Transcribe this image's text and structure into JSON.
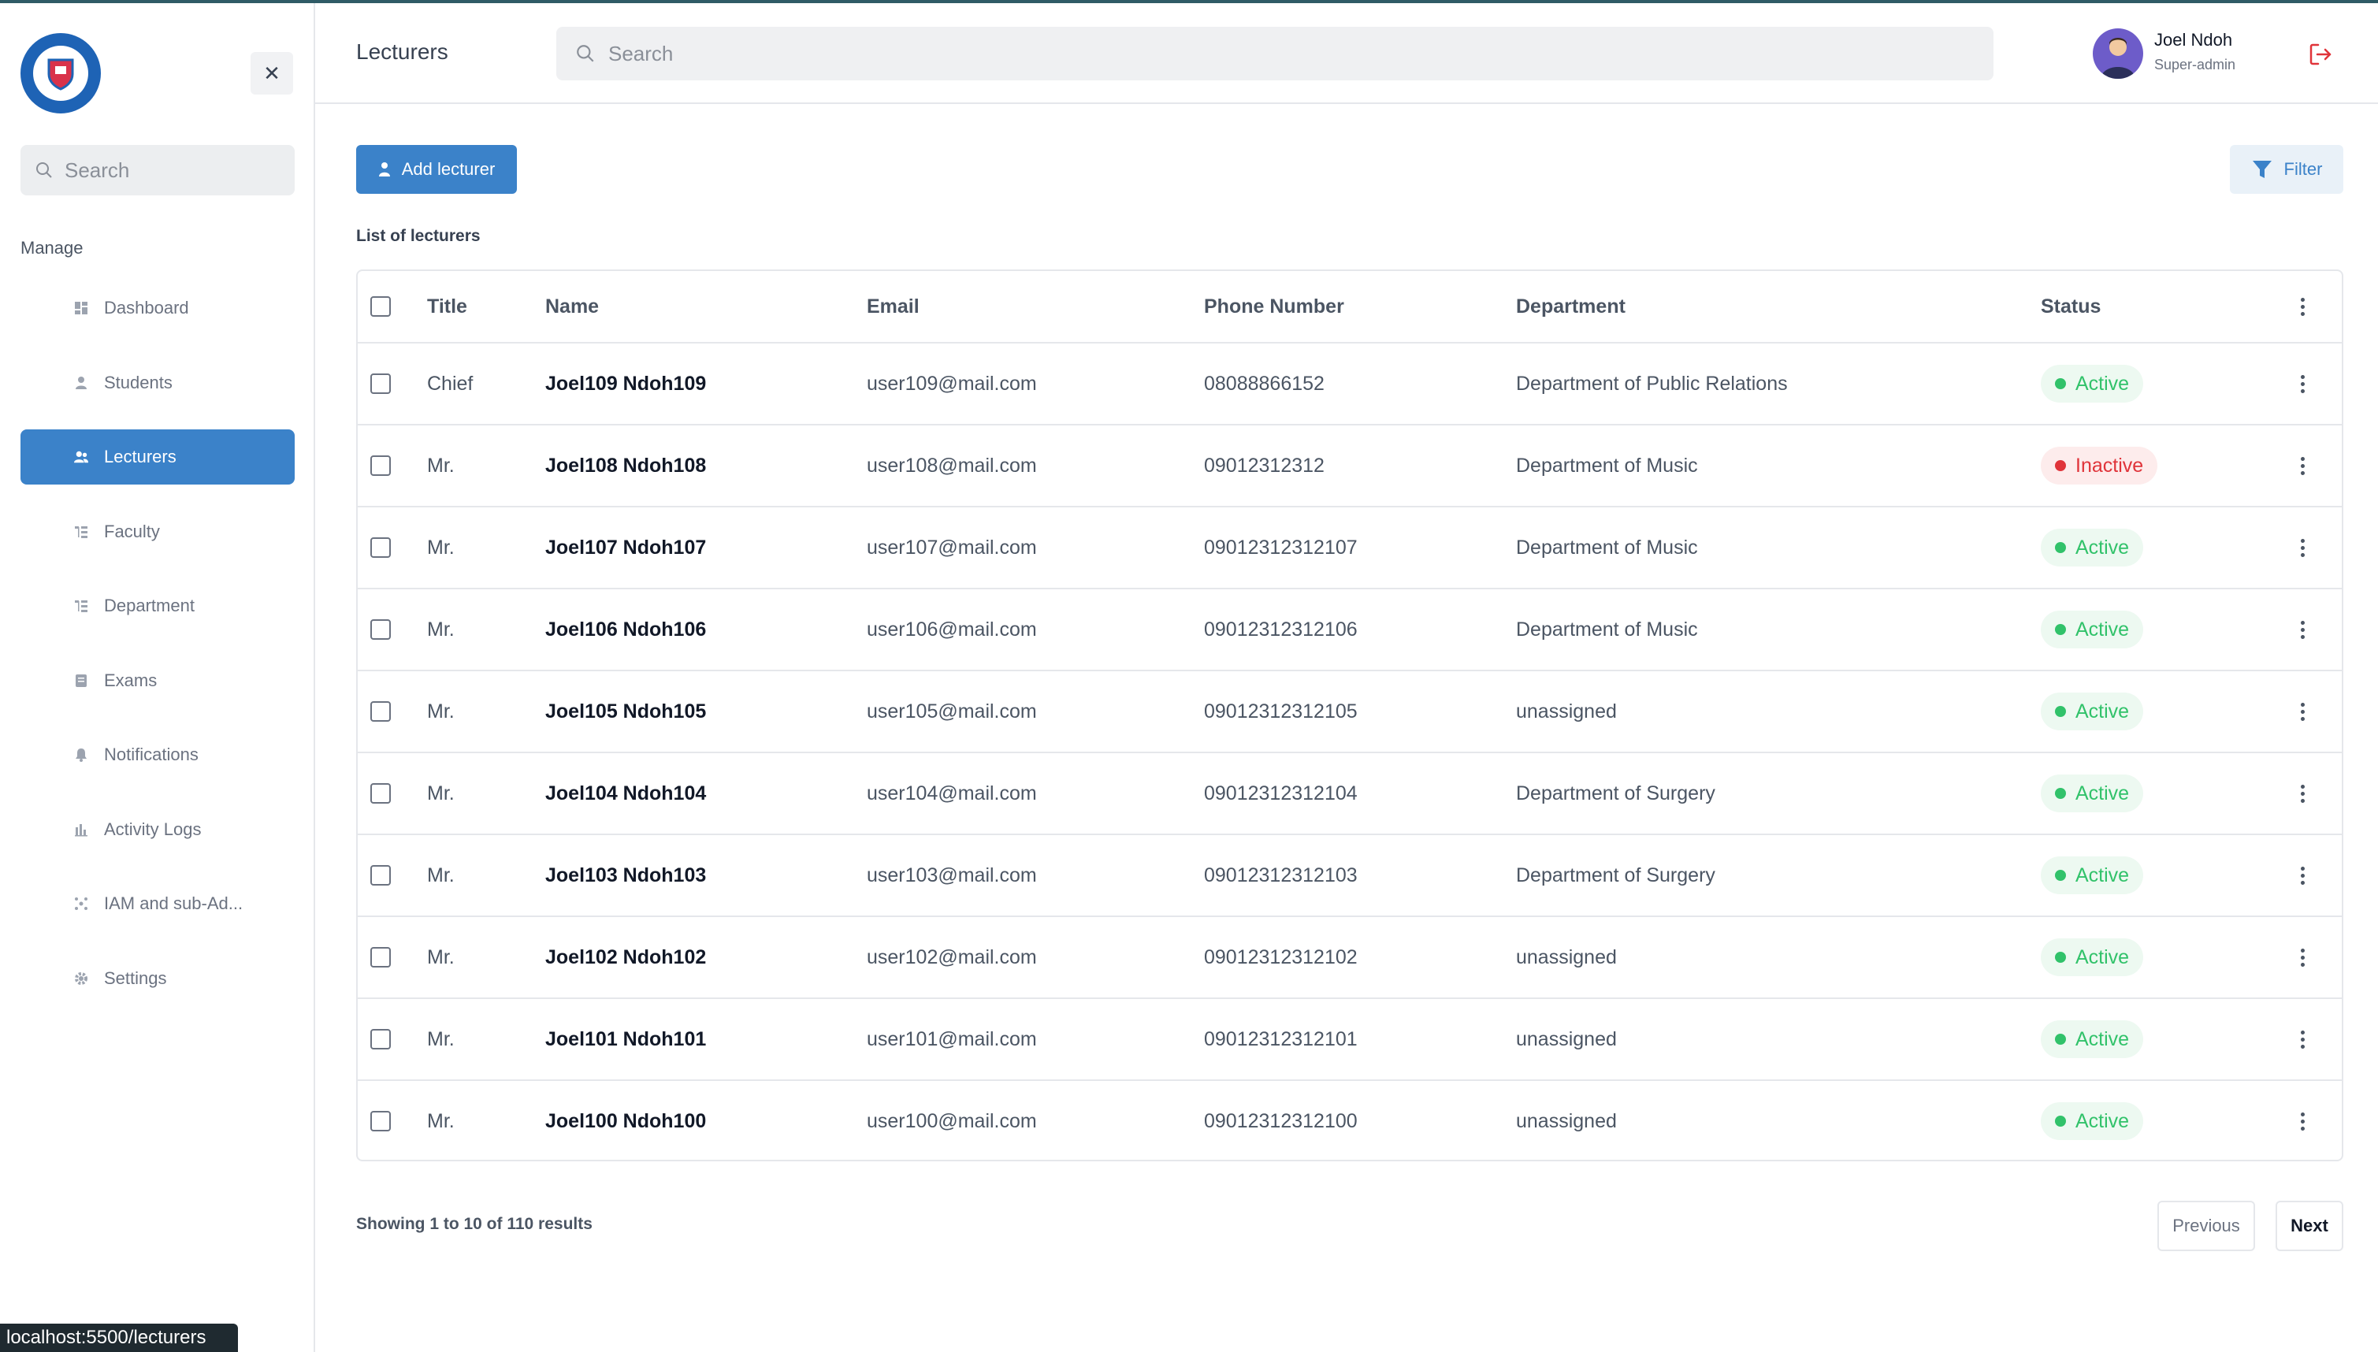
{
  "sidebar": {
    "search_placeholder": "Search",
    "section_label": "Manage",
    "items": [
      {
        "label": "Dashboard",
        "icon": "dashboard-icon"
      },
      {
        "label": "Students",
        "icon": "user-icon"
      },
      {
        "label": "Lecturers",
        "icon": "users-icon",
        "active": true
      },
      {
        "label": "Faculty",
        "icon": "tree-icon"
      },
      {
        "label": "Department",
        "icon": "tree-icon"
      },
      {
        "label": "Exams",
        "icon": "document-icon"
      },
      {
        "label": "Notifications",
        "icon": "bell-icon"
      },
      {
        "label": "Activity Logs",
        "icon": "bar-chart-icon"
      },
      {
        "label": "IAM and sub-Ad...",
        "icon": "network-icon"
      },
      {
        "label": "Settings",
        "icon": "gear-icon"
      }
    ]
  },
  "header": {
    "title": "Lecturers",
    "search_placeholder": "Search",
    "user_name": "Joel Ndoh",
    "user_role": "Super-admin"
  },
  "main": {
    "add_label": "Add lecturer",
    "filter_label": "Filter",
    "list_label": "List of lecturers",
    "columns": [
      "Title",
      "Name",
      "Email",
      "Phone Number",
      "Department",
      "Status"
    ],
    "rows": [
      {
        "title": "Chief",
        "name": "Joel109 Ndoh109",
        "email": "user109@mail.com",
        "phone": "08088866152",
        "department": "Department of Public Relations",
        "status": "Active"
      },
      {
        "title": "Mr.",
        "name": "Joel108 Ndoh108",
        "email": "user108@mail.com",
        "phone": "09012312312",
        "department": "Department of Music",
        "status": "Inactive"
      },
      {
        "title": "Mr.",
        "name": "Joel107 Ndoh107",
        "email": "user107@mail.com",
        "phone": "09012312312107",
        "department": "Department of Music",
        "status": "Active"
      },
      {
        "title": "Mr.",
        "name": "Joel106 Ndoh106",
        "email": "user106@mail.com",
        "phone": "09012312312106",
        "department": "Department of Music",
        "status": "Active"
      },
      {
        "title": "Mr.",
        "name": "Joel105 Ndoh105",
        "email": "user105@mail.com",
        "phone": "09012312312105",
        "department": "unassigned",
        "status": "Active"
      },
      {
        "title": "Mr.",
        "name": "Joel104 Ndoh104",
        "email": "user104@mail.com",
        "phone": "09012312312104",
        "department": "Department of Surgery",
        "status": "Active"
      },
      {
        "title": "Mr.",
        "name": "Joel103 Ndoh103",
        "email": "user103@mail.com",
        "phone": "09012312312103",
        "department": "Department of Surgery",
        "status": "Active"
      },
      {
        "title": "Mr.",
        "name": "Joel102 Ndoh102",
        "email": "user102@mail.com",
        "phone": "09012312312102",
        "department": "unassigned",
        "status": "Active"
      },
      {
        "title": "Mr.",
        "name": "Joel101 Ndoh101",
        "email": "user101@mail.com",
        "phone": "09012312312101",
        "department": "unassigned",
        "status": "Active"
      },
      {
        "title": "Mr.",
        "name": "Joel100 Ndoh100",
        "email": "user100@mail.com",
        "phone": "09012312312100",
        "department": "unassigned",
        "status": "Active"
      }
    ],
    "pagination": {
      "summary": "Showing 1 to 10 of 110 results",
      "previous_label": "Previous",
      "next_label": "Next"
    }
  },
  "statusbar": {
    "url": "localhost:5500/lecturers"
  },
  "colors": {
    "accent": "#3b82c9",
    "active": "#31c26a",
    "inactive": "#e0343a",
    "logout": "#e0343a"
  }
}
